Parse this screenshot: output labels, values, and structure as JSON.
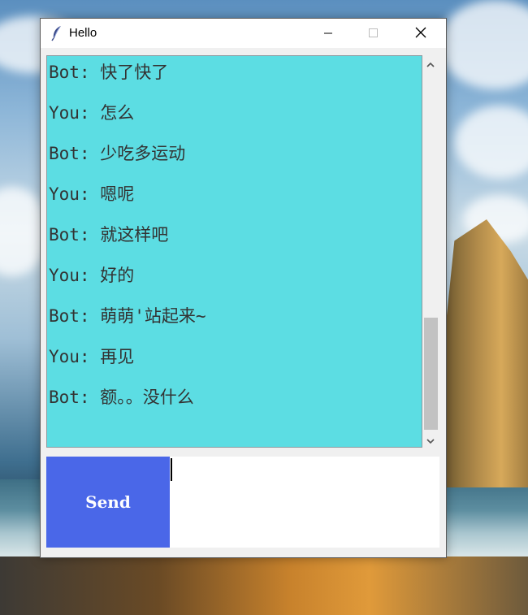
{
  "window": {
    "title": "Hello",
    "app_icon": "feather-icon"
  },
  "titlebar_buttons": {
    "minimize_icon": "minimize-icon",
    "maximize_icon": "maximize-icon",
    "close_icon": "close-icon"
  },
  "chat": {
    "background": "#5cdde3",
    "messages": [
      "Bot: 快了快了",
      "You: 怎么",
      "Bot: 少吃多运动",
      "You: 嗯呢",
      "Bot: 就这样吧",
      "You: 好的",
      "Bot: 萌萌'站起来~",
      "You: 再见",
      "Bot: 额。。没什么"
    ]
  },
  "send_button": {
    "label": "Send",
    "color": "#4a67e8"
  },
  "input": {
    "value": ""
  }
}
